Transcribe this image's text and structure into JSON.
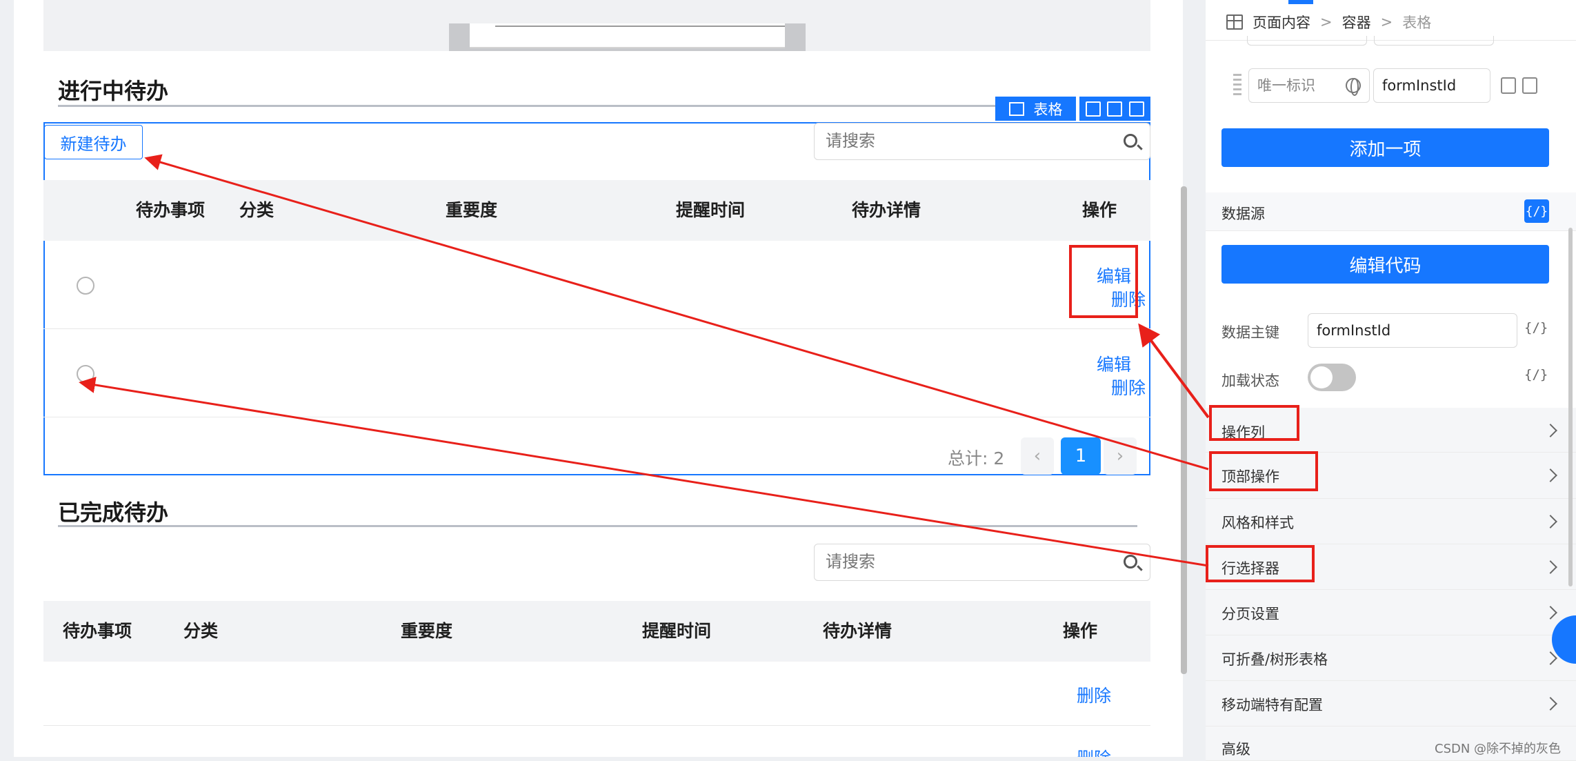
{
  "canvas": {
    "section1": {
      "title": "进行中待办",
      "new_button": "新建待办",
      "search_placeholder": "请搜索",
      "selected_tag": "表格",
      "headers": [
        "待办事项",
        "分类",
        "重要度",
        "提醒时间",
        "待办详情",
        "操作"
      ],
      "row_actions": {
        "edit": "编辑",
        "delete": "删除"
      },
      "rows": 2,
      "total": "总计: 2",
      "current_page": "1"
    },
    "section2": {
      "title": "已完成待办",
      "search_placeholder": "请搜索",
      "headers": [
        "待办事项",
        "分类",
        "重要度",
        "提醒时间",
        "待办详情",
        "操作"
      ],
      "row_action": "删除",
      "row_action_partial": "删除"
    }
  },
  "panel": {
    "breadcrumb": [
      "页面内容",
      "容器",
      "表格"
    ],
    "unique_id_placeholder": "唯一标识",
    "unique_id_value": "formInstId",
    "add_item_button": "添加一项",
    "datasource_label": "数据源",
    "code_badge": "{/}",
    "edit_code_button": "编辑代码",
    "primary_key_label": "数据主键",
    "primary_key_value": "formInstId",
    "loading_label": "加载状态",
    "loading_on": false,
    "sections": [
      "操作列",
      "顶部操作",
      "风格和样式",
      "行选择器",
      "分页设置",
      "可折叠/树形表格",
      "移动端特有配置",
      "高级"
    ]
  },
  "watermark": "CSDN @除不掉的灰色",
  "colors": {
    "accent": "#1677ff",
    "annotation": "#e8201a"
  }
}
